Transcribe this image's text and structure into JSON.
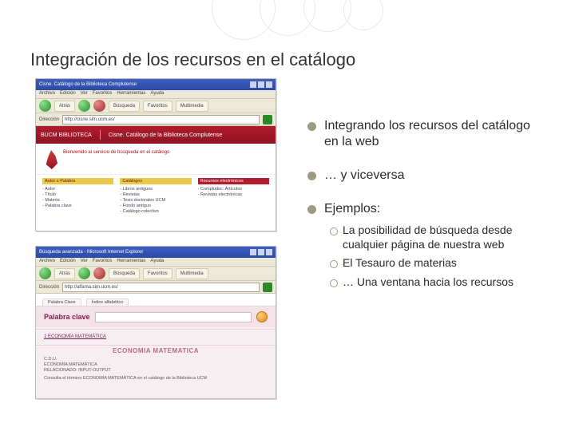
{
  "title": "Integración de los recursos en el catálogo",
  "bullets": {
    "b1": "Integrando los recursos del catálogo en la web",
    "b2": "… y viceversa",
    "b3": "Ejemplos:"
  },
  "subs": {
    "s1": "La posibilidad de búsqueda desde cualquier página de nuestra web",
    "s2": "El Tesauro de materias",
    "s3": "… Una ventana hacia los recursos"
  },
  "shot1": {
    "window_title": "Cisne. Catálogo de la Biblioteca Complutense",
    "menu": {
      "m1": "Archivo",
      "m2": "Edición",
      "m3": "Ver",
      "m4": "Favoritos",
      "m5": "Herramientas",
      "m6": "Ayuda"
    },
    "toolbar": {
      "back": "Atrás",
      "search": "Búsqueda",
      "favs": "Favoritos",
      "media": "Multimedia"
    },
    "address_label": "Dirección",
    "address_value": "http://cisne.sim.ucm.es/",
    "brand": "BUCM BIBLIOTECA",
    "tagline": "Cisne. Catálogo de la Biblioteca Complutense",
    "hero_line1": "Bienvenido al servicio de búsqueda en el catálogo",
    "hero_line2": "",
    "col1_head": "Autor o Palabra",
    "col1_items": {
      "a": "Autor",
      "b": "Título",
      "c": "Materia",
      "d": "Palabra clave"
    },
    "col2_head": "Catálogos",
    "col2_items": {
      "a": "Libros antiguos",
      "b": "Revistas",
      "c": "Tesis doctorales UCM",
      "d": "Fondo antiguo",
      "e": "Catálogo colectivo"
    },
    "col3_head": "Recursos electrónicos",
    "col3_items": {
      "a": "Compludoc: Artículos",
      "b": "Revistas electrónicas"
    }
  },
  "shot2": {
    "window_title": "Búsqueda avanzada - Microsoft Internet Explorer",
    "menu": {
      "m1": "Archivo",
      "m2": "Edición",
      "m3": "Ver",
      "m4": "Favoritos",
      "m5": "Herramientas",
      "m6": "Ayuda"
    },
    "toolbar": {
      "back": "Atrás",
      "search": "Búsqueda",
      "favs": "Favoritos",
      "media": "Multimedia"
    },
    "address_label": "Dirección",
    "address_value": "http://alfama.sim.ucm.es/",
    "tab1": "Palabra Clave",
    "tab2": "Índice alfabético",
    "keyword_label": "Palabra clave",
    "hit": "1 ECONOMÍA MATEMÁTICA",
    "record_title": "ECONOMIA MATEMATICA",
    "cdu_label": "C.D.U.",
    "cdu_value": "ECONOMÍA MATEMÁTICA",
    "related_label": "RELACIONADO: INPUT-OUTPUT",
    "note": "Consulta el término ECONOMÍA MATEMÁTICA en el catálogo de la Biblioteca UCM"
  }
}
